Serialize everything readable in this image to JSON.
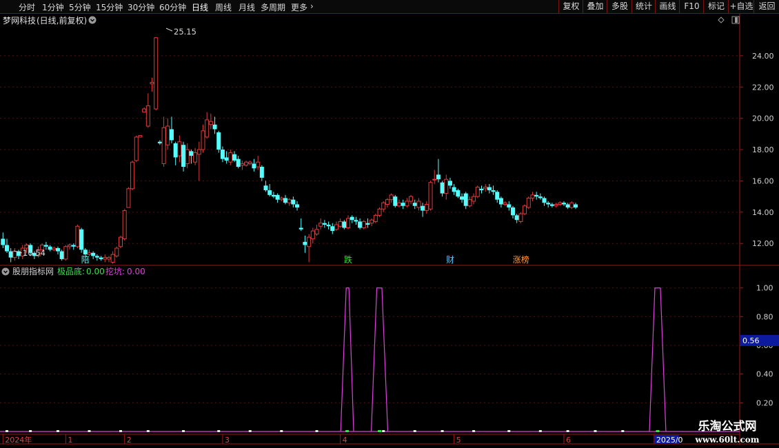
{
  "toolbar": {
    "periods": [
      "分时",
      "1分钟",
      "5分钟",
      "15分钟",
      "30分钟",
      "60分钟",
      "日线",
      "周线",
      "月线",
      "多周期",
      "更多"
    ],
    "more_arrow": "›",
    "right_buttons": [
      "复权",
      "叠加",
      "多股",
      "统计",
      "画线",
      "F10",
      "标记",
      "+自选",
      "返回"
    ]
  },
  "main_panel": {
    "stock_name": "梦网科技",
    "mode": "(日线,前复权)"
  },
  "indicator_panel": {
    "name": "股朋指标网",
    "series": [
      {
        "label": "极品底:",
        "value": "0.00",
        "color": "#36e24a"
      },
      {
        "label": "挖坑:",
        "value": "0.00",
        "color": "#e040e0"
      }
    ],
    "cursor_value": "0.56"
  },
  "watermark": {
    "title": "乐淘公式网",
    "url": "www.60lt.com"
  },
  "chart_data": [
    {
      "type": "candlestick",
      "title": "梦网科技(日线,前复权)",
      "ylim": [
        10.6,
        25.8
      ],
      "y_ticks": [
        "12.00",
        "14.00",
        "16.00",
        "18.00",
        "20.00",
        "22.00",
        "24.00"
      ],
      "max_label": "25.15",
      "min_label": "10.54",
      "up_color": "#e23b3b",
      "down_color": "#54ffff",
      "event_labels": [
        {
          "text": "陪",
          "index": 21,
          "color": "#54ffff"
        },
        {
          "text": "跌",
          "index": 88,
          "color": "#3cdc3c"
        },
        {
          "text": "财",
          "index": 114,
          "color": "#54c8ff"
        },
        {
          "text": "涨榜",
          "index": 131,
          "color": "#ff9a3c"
        }
      ],
      "candles": [
        [
          12.3,
          11.9,
          12.7,
          11.7
        ],
        [
          11.9,
          11.5,
          12.3,
          11.4
        ],
        [
          11.5,
          11.1,
          11.7,
          10.8
        ],
        [
          11.1,
          11.5,
          11.7,
          10.9
        ],
        [
          11.5,
          11.2,
          11.6,
          11.0
        ],
        [
          11.2,
          11.7,
          11.9,
          11.0
        ],
        [
          11.7,
          11.9,
          12.0,
          11.4
        ],
        [
          11.9,
          11.4,
          12.0,
          11.2
        ],
        [
          11.4,
          11.2,
          11.5,
          11.0
        ],
        [
          11.2,
          11.6,
          11.8,
          11.1
        ],
        [
          11.6,
          11.9,
          12.0,
          11.4
        ],
        [
          11.9,
          11.8,
          12.1,
          11.6
        ],
        [
          11.8,
          11.6,
          11.9,
          11.5
        ],
        [
          11.6,
          11.7,
          11.8,
          11.5
        ],
        [
          11.7,
          11.5,
          11.8,
          11.3
        ],
        [
          11.5,
          11.0,
          11.6,
          10.9
        ],
        [
          11.0,
          11.8,
          11.9,
          10.9
        ],
        [
          11.8,
          11.9,
          12.0,
          11.6
        ],
        [
          11.9,
          11.8,
          12.0,
          11.6
        ],
        [
          11.8,
          13.1,
          13.2,
          11.7
        ],
        [
          12.9,
          11.6,
          13.0,
          11.4
        ],
        [
          11.6,
          11.3,
          11.7,
          11.1
        ],
        [
          11.3,
          11.4,
          11.6,
          11.2
        ],
        [
          11.4,
          11.2,
          11.5,
          11.0
        ],
        [
          11.2,
          11.1,
          11.3,
          10.9
        ],
        [
          11.1,
          11.0,
          11.2,
          10.9
        ],
        [
          11.0,
          11.1,
          11.3,
          10.8
        ],
        [
          11.0,
          11.1,
          11.2,
          10.8
        ],
        [
          10.8,
          11.3,
          11.5,
          10.7
        ],
        [
          11.2,
          11.7,
          11.8,
          11.1
        ],
        [
          11.8,
          12.4,
          12.5,
          11.7
        ],
        [
          12.3,
          14.1,
          14.2,
          12.2
        ],
        [
          14.3,
          15.5,
          15.6,
          14.4
        ],
        [
          15.5,
          17.2,
          17.3,
          15.4
        ],
        [
          17.3,
          18.8,
          18.9,
          17.2
        ],
        [
          18.8,
          18.9,
          18.9,
          18.8
        ],
        [
          20.4,
          20.6,
          20.7,
          20.4
        ],
        [
          19.5,
          20.8,
          21.6,
          19.4
        ],
        [
          22.2,
          22.3,
          22.6,
          21.7
        ],
        [
          20.6,
          25.15,
          25.2,
          20.5
        ],
        [
          18.5,
          18.4,
          18.6,
          18.3
        ],
        [
          17.1,
          19.4,
          20.1,
          16.9
        ],
        [
          18.3,
          19.5,
          20.0,
          18.0
        ],
        [
          19.3,
          18.6,
          20.1,
          18.4
        ],
        [
          18.4,
          17.5,
          18.5,
          17.0
        ],
        [
          17.6,
          18.5,
          18.9,
          17.2
        ],
        [
          18.3,
          16.9,
          18.5,
          16.6
        ],
        [
          17.1,
          18.0,
          18.4,
          16.8
        ],
        [
          17.9,
          17.6,
          18.0,
          17.1
        ],
        [
          17.2,
          17.8,
          18.1,
          17.0
        ],
        [
          17.7,
          18.0,
          18.5,
          16.0
        ],
        [
          18.0,
          19.2,
          19.6,
          17.8
        ],
        [
          18.8,
          19.9,
          20.4,
          18.7
        ],
        [
          19.6,
          19.8,
          20.3,
          19.3
        ],
        [
          19.6,
          19.3,
          20.1,
          19.0
        ],
        [
          19.1,
          18.0,
          19.2,
          17.8
        ],
        [
          18.0,
          17.4,
          18.2,
          17.2
        ],
        [
          17.5,
          17.3,
          17.9,
          17.1
        ],
        [
          17.2,
          17.8,
          18.0,
          17.0
        ],
        [
          17.7,
          17.3,
          17.9,
          17.2
        ],
        [
          17.4,
          16.9,
          17.6,
          16.8
        ],
        [
          17.0,
          17.1,
          17.3,
          16.7
        ],
        [
          17.0,
          17.2,
          17.3,
          16.9
        ],
        [
          17.1,
          17.2,
          17.3,
          17.0
        ],
        [
          17.1,
          16.8,
          17.4,
          16.6
        ],
        [
          16.9,
          17.2,
          17.6,
          16.7
        ],
        [
          16.9,
          16.2,
          17.0,
          16.0
        ],
        [
          15.7,
          15.4,
          16.0,
          15.3
        ],
        [
          15.4,
          15.1,
          15.8,
          15.0
        ],
        [
          15.1,
          15.0,
          15.3,
          14.9
        ],
        [
          15.1,
          14.8,
          15.2,
          14.6
        ],
        [
          14.8,
          14.9,
          15.0,
          14.7
        ],
        [
          14.9,
          14.6,
          15.1,
          14.5
        ],
        [
          14.6,
          14.8,
          14.9,
          14.4
        ],
        [
          14.8,
          14.5,
          15.0,
          14.3
        ],
        [
          14.5,
          14.3,
          14.7,
          14.1
        ],
        [
          13.0,
          12.9,
          13.6,
          12.8
        ],
        [
          12.1,
          11.9,
          12.5,
          11.4
        ],
        [
          11.8,
          12.4,
          12.6,
          10.8
        ],
        [
          12.3,
          12.8,
          13.0,
          12.0
        ],
        [
          12.6,
          12.9,
          13.2,
          12.5
        ],
        [
          13.1,
          13.3,
          13.6,
          12.9
        ],
        [
          13.3,
          13.2,
          13.5,
          13.0
        ],
        [
          13.2,
          13.1,
          13.4,
          12.9
        ],
        [
          13.1,
          12.8,
          13.3,
          12.6
        ],
        [
          12.9,
          13.2,
          13.4,
          12.8
        ],
        [
          13.1,
          13.4,
          13.6,
          13.0
        ],
        [
          13.4,
          13.0,
          13.5,
          12.9
        ],
        [
          13.0,
          13.6,
          13.8,
          12.9
        ],
        [
          13.7,
          13.5,
          13.8,
          13.3
        ],
        [
          13.5,
          13.4,
          13.7,
          13.2
        ],
        [
          13.4,
          13.0,
          13.6,
          12.9
        ],
        [
          13.0,
          13.4,
          13.5,
          12.9
        ],
        [
          13.3,
          13.2,
          13.6,
          13.0
        ],
        [
          13.3,
          13.5,
          13.6,
          13.1
        ],
        [
          13.4,
          13.8,
          13.9,
          13.3
        ],
        [
          13.8,
          14.2,
          14.3,
          13.7
        ],
        [
          14.2,
          14.6,
          14.7,
          14.0
        ],
        [
          14.5,
          14.8,
          14.9,
          14.3
        ],
        [
          14.8,
          15.1,
          15.2,
          14.6
        ],
        [
          15.0,
          14.4,
          15.1,
          14.3
        ],
        [
          14.4,
          14.6,
          14.8,
          14.3
        ],
        [
          14.6,
          14.4,
          14.8,
          14.2
        ],
        [
          14.4,
          14.7,
          14.9,
          14.3
        ],
        [
          14.7,
          15.0,
          15.1,
          14.5
        ],
        [
          14.6,
          14.4,
          14.8,
          14.2
        ],
        [
          14.3,
          14.7,
          14.9,
          14.1
        ],
        [
          14.4,
          14.1,
          14.6,
          13.7
        ],
        [
          14.1,
          14.5,
          14.7,
          13.9
        ],
        [
          14.2,
          15.9,
          16.0,
          14.1
        ],
        [
          16.1,
          16.1,
          16.7,
          15.8
        ],
        [
          16.4,
          16.1,
          17.4,
          15.9
        ],
        [
          15.9,
          15.2,
          16.0,
          15.0
        ],
        [
          15.2,
          16.1,
          16.4,
          14.8
        ],
        [
          16.0,
          15.7,
          16.2,
          15.5
        ],
        [
          15.6,
          15.3,
          15.8,
          15.1
        ],
        [
          15.4,
          15.0,
          15.5,
          14.9
        ],
        [
          15.0,
          14.8,
          15.2,
          14.6
        ],
        [
          15.2,
          14.4,
          15.3,
          14.2
        ],
        [
          14.4,
          14.8,
          15.0,
          14.3
        ],
        [
          14.7,
          15.0,
          15.2,
          14.5
        ],
        [
          15.0,
          15.6,
          15.7,
          14.9
        ],
        [
          15.5,
          15.4,
          15.7,
          15.2
        ],
        [
          15.5,
          15.6,
          15.8,
          15.3
        ],
        [
          15.6,
          15.4,
          15.8,
          15.2
        ],
        [
          15.4,
          15.3,
          15.7,
          15.1
        ],
        [
          15.3,
          14.8,
          15.4,
          14.6
        ],
        [
          14.9,
          14.5,
          15.0,
          14.3
        ],
        [
          14.5,
          14.6,
          14.7,
          14.4
        ],
        [
          14.5,
          14.3,
          14.7,
          14.1
        ],
        [
          14.3,
          13.8,
          14.4,
          13.6
        ],
        [
          13.8,
          13.5,
          13.9,
          13.3
        ],
        [
          13.4,
          13.9,
          14.0,
          13.3
        ],
        [
          13.9,
          14.4,
          14.5,
          13.8
        ],
        [
          14.3,
          14.9,
          15.0,
          14.2
        ],
        [
          14.9,
          15.1,
          15.3,
          14.7
        ],
        [
          15.1,
          15.0,
          15.3,
          14.8
        ],
        [
          15.0,
          14.9,
          15.2,
          14.8
        ],
        [
          14.9,
          14.6,
          15.0,
          14.4
        ],
        [
          14.6,
          14.5,
          14.7,
          14.3
        ],
        [
          14.5,
          14.4,
          14.6,
          14.3
        ],
        [
          14.4,
          14.5,
          14.6,
          14.3
        ],
        [
          14.5,
          14.6,
          14.7,
          14.4
        ],
        [
          14.6,
          14.5,
          14.7,
          14.4
        ],
        [
          14.5,
          14.3,
          14.6,
          14.2
        ],
        [
          14.3,
          14.6,
          14.7,
          14.2
        ],
        [
          14.5,
          14.3,
          14.6,
          14.2
        ]
      ],
      "x_ticks": [
        {
          "label": "2024年",
          "index": 0
        },
        {
          "label": "1",
          "index": 16
        },
        {
          "label": "2",
          "index": 31
        },
        {
          "label": "3",
          "index": 56
        },
        {
          "label": "4",
          "index": 86
        },
        {
          "label": "5",
          "index": 115
        },
        {
          "label": "6",
          "index": 143
        },
        {
          "label": "2025/0",
          "index": 166
        }
      ]
    },
    {
      "type": "line",
      "series_name": "挖坑",
      "ylim": [
        0.0,
        1.09
      ],
      "y_ticks": [
        "0.20",
        "0.40",
        "0.60",
        "0.80",
        "1.00"
      ],
      "line_color": "#e040e0",
      "spikes": [
        {
          "start": 86.1,
          "top_start": 87.5,
          "top_end": 88.2,
          "end": 89.4
        },
        {
          "start": 93.9,
          "top_start": 95.3,
          "top_end": 96.6,
          "end": 98.1
        },
        {
          "start": 164.8,
          "top_start": 166.2,
          "top_end": 167.6,
          "end": 169.0
        }
      ],
      "base_markers": [
        1,
        7,
        14,
        22,
        30,
        37,
        46,
        55,
        63,
        71,
        80,
        97,
        105,
        112,
        120,
        129,
        137,
        144,
        151,
        158
      ]
    }
  ]
}
